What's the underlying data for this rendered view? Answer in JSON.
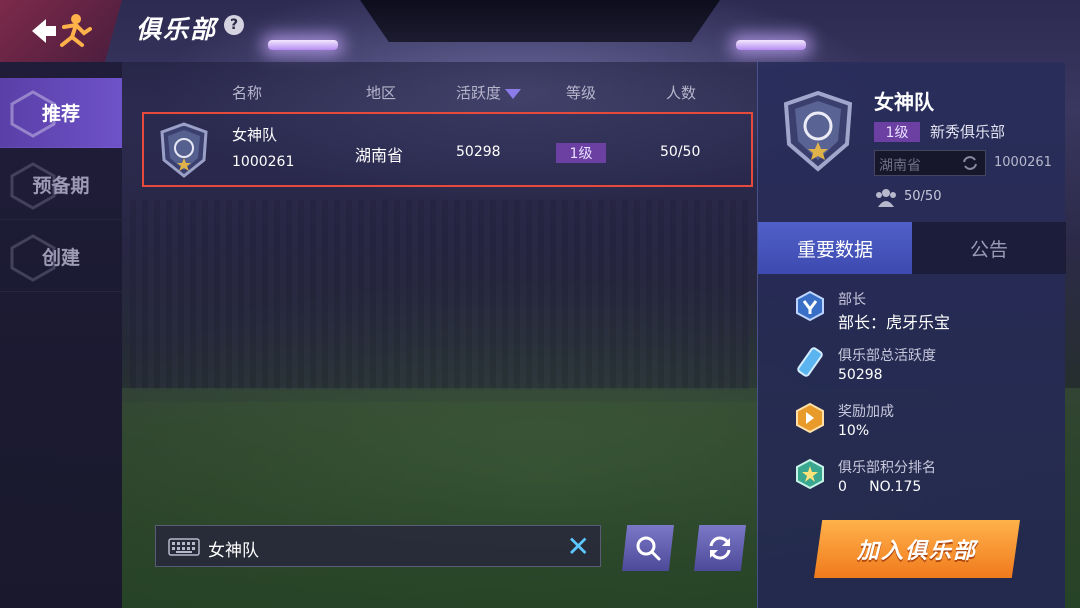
{
  "header": {
    "title": "俱乐部",
    "help": "?"
  },
  "sidebar": {
    "tabs": [
      {
        "label": "推荐",
        "active": true
      },
      {
        "label": "预备期",
        "active": false
      },
      {
        "label": "创建",
        "active": false
      }
    ]
  },
  "list": {
    "columns": {
      "name": "名称",
      "region": "地区",
      "activity": "活跃度",
      "level": "等级",
      "members": "人数"
    },
    "rows": [
      {
        "name": "女神队",
        "id": "1000261",
        "region": "湖南省",
        "activity": "50298",
        "level": "1级",
        "members": "50/50",
        "selected": true
      }
    ]
  },
  "search": {
    "value": "女神队"
  },
  "detail": {
    "name": "女神队",
    "level": "1级",
    "tier": "新秀俱乐部",
    "region": "湖南省",
    "id": "1000261",
    "members": "50/50",
    "tabs": {
      "data": "重要数据",
      "notice": "公告"
    },
    "stats": [
      {
        "label": "部长",
        "value": "部长：虎牙乐宝",
        "icon": "captain-icon"
      },
      {
        "label": "俱乐部总活跃度",
        "value": "50298",
        "icon": "activity-icon"
      },
      {
        "label": "奖励加成",
        "value": "10%",
        "icon": "bonus-icon"
      },
      {
        "label": "俱乐部积分排名",
        "value": "0     NO.175",
        "icon": "rank-icon"
      }
    ],
    "join_label": "加入俱乐部"
  },
  "colors": {
    "accent_orange": "#f07a1e",
    "selection_border": "#e64a3c",
    "level_badge": "#6c3fa3",
    "active_tab": "#5a3fa8"
  }
}
